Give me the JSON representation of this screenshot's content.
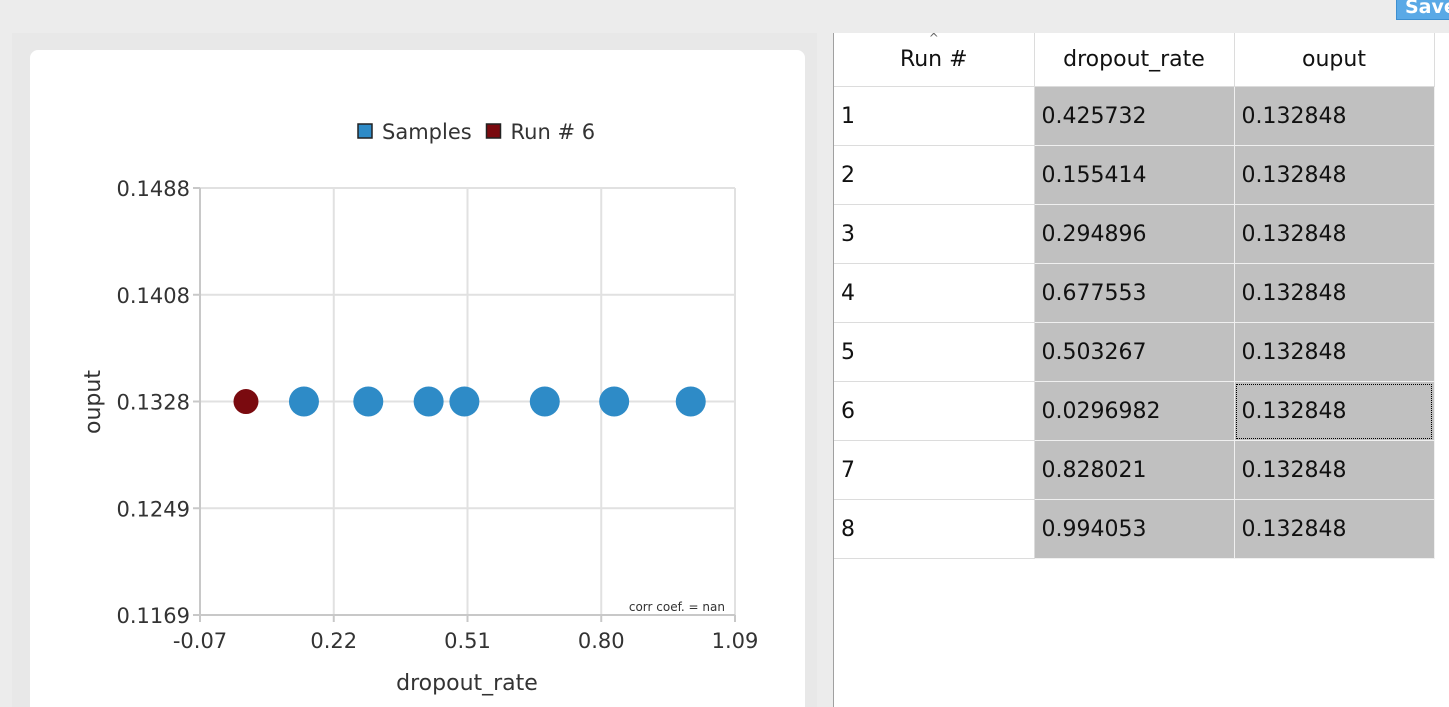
{
  "toolbar": {
    "save_label": "Save"
  },
  "chart_data": {
    "type": "scatter",
    "xlabel": "dropout_rate",
    "ylabel": "ouput",
    "xlim": [
      -0.07,
      1.09
    ],
    "ylim": [
      0.1169,
      0.1488
    ],
    "x_ticks": [
      "-0.07",
      "0.22",
      "0.51",
      "0.80",
      "1.09"
    ],
    "y_ticks": [
      "0.1488",
      "0.1408",
      "0.1328",
      "0.1249",
      "0.1169"
    ],
    "grid": true,
    "legend_position": "top",
    "annotation": "corr coef. = nan",
    "series": [
      {
        "name": "Samples",
        "color": "#2e8bc7",
        "x": [
          0.425732,
          0.155414,
          0.294896,
          0.677553,
          0.503267,
          0.828021,
          0.994053
        ],
        "y": [
          0.132848,
          0.132848,
          0.132848,
          0.132848,
          0.132848,
          0.132848,
          0.132848
        ]
      },
      {
        "name": "Run # 6",
        "color": "#7a0a0f",
        "x": [
          0.0296982
        ],
        "y": [
          0.132848
        ]
      }
    ]
  },
  "table": {
    "sort_indicator": "^",
    "columns": [
      "Run #",
      "dropout_rate",
      "ouput"
    ],
    "rows": [
      [
        "1",
        "0.425732",
        "0.132848"
      ],
      [
        "2",
        "0.155414",
        "0.132848"
      ],
      [
        "3",
        "0.294896",
        "0.132848"
      ],
      [
        "4",
        "0.677553",
        "0.132848"
      ],
      [
        "5",
        "0.503267",
        "0.132848"
      ],
      [
        "6",
        "0.0296982",
        "0.132848"
      ],
      [
        "7",
        "0.828021",
        "0.132848"
      ],
      [
        "8",
        "0.994053",
        "0.132848"
      ]
    ],
    "focused_cell": [
      5,
      2
    ]
  }
}
